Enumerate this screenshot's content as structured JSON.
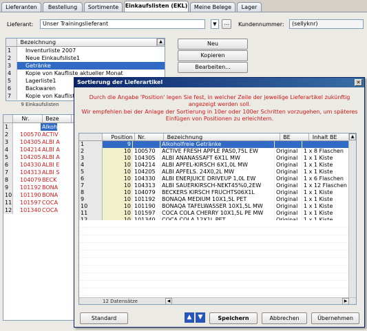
{
  "tabs": [
    "Lieferanten",
    "Bestellung",
    "Sortimente",
    "Einkaufslisten (EKL)",
    "Meine Belege",
    "Lager"
  ],
  "active_tab": 3,
  "supplier": {
    "label": "Lieferant:",
    "value": "Unser Trainingslieferant",
    "customer_label": "Kundennummer:",
    "customer_value": "(sellyknr)",
    "more_button": "..."
  },
  "purchase_lists": {
    "header": "Bezeichnung",
    "rows": [
      {
        "num": "1",
        "name": "Inventurliste 2007"
      },
      {
        "num": "2",
        "name": "Neue Einkaufsliste1"
      },
      {
        "num": "3",
        "name": "Getränke"
      },
      {
        "num": "4",
        "name": "Kopie von Kaufliste aktueller Monat"
      },
      {
        "num": "5",
        "name": "Lagerliste1"
      },
      {
        "num": "6",
        "name": "Backwaren"
      },
      {
        "num": "7",
        "name": "Kopie von Kaufliste aktueller Monat"
      }
    ],
    "selected": 2,
    "footer": "9 Einkaufslisten"
  },
  "side_buttons": {
    "new": "Neu",
    "copy": "Kopieren",
    "edit": "Bearbeiten..."
  },
  "items_list": {
    "headers": [
      "Nr.",
      "Beze"
    ],
    "rows": [
      {
        "num": "1",
        "nr": "",
        "name": "Alkoh"
      },
      {
        "num": "2",
        "nr": "100570",
        "name": "ACTIV"
      },
      {
        "num": "3",
        "nr": "104305",
        "name": "ALBI A"
      },
      {
        "num": "4",
        "nr": "104214",
        "name": "ALBI A"
      },
      {
        "num": "5",
        "nr": "104205",
        "name": "ALBI A"
      },
      {
        "num": "6",
        "nr": "104330",
        "name": "ALBI E"
      },
      {
        "num": "7",
        "nr": "104313",
        "name": "ALBI S"
      },
      {
        "num": "8",
        "nr": "104079",
        "name": "BECK"
      },
      {
        "num": "9",
        "nr": "101192",
        "name": "BONA"
      },
      {
        "num": "10",
        "nr": "101190",
        "name": "BONA"
      },
      {
        "num": "11",
        "nr": "101597",
        "name": "COCA"
      },
      {
        "num": "12",
        "nr": "101340",
        "name": "COCA"
      }
    ]
  },
  "dialog": {
    "title": "Sortierung der Lieferartikel",
    "info_line1": "Durch die Angabe 'Position' legen Sie fest, in welcher Zeile der jeweilige Lieferartikel zukünftig angezeigt werden soll.",
    "info_line2": "Wir empfehlen bei der Anlage der Sortierung in 10er oder 100er Schritten vorzugehen, um späteres Einfügen von Positionen zu erleichtern.",
    "columns": [
      "Position",
      "Nr.",
      "Bezeichnung",
      "BE",
      "Inhalt BE"
    ],
    "rows": [
      {
        "num": "1",
        "pos": "9",
        "nr": "",
        "name": "Alkoholfreie Getränke",
        "be": "",
        "inhalt": ""
      },
      {
        "num": "2",
        "pos": "10",
        "nr": "100570",
        "name": "ACTIVE FRESH APPLE PAS0,75L EW",
        "be": "Original",
        "inhalt": "1 x 8 Flaschen"
      },
      {
        "num": "3",
        "pos": "10",
        "nr": "104305",
        "name": "ALBI ANANASSAFT 6X1L MW",
        "be": "Original",
        "inhalt": "1 x 1 Kiste"
      },
      {
        "num": "4",
        "pos": "10",
        "nr": "104214",
        "name": "ALBI APFEL-KIRSCH 6X1,0L MW",
        "be": "Original",
        "inhalt": "1 x 1 Kiste"
      },
      {
        "num": "5",
        "pos": "10",
        "nr": "104205",
        "name": "ALBI APFELS. 24X0,2L MW",
        "be": "Original",
        "inhalt": "1 x 1 Kiste"
      },
      {
        "num": "6",
        "pos": "10",
        "nr": "104330",
        "name": "ALBI ENERJUICE DRIVEUP 1,0L EW",
        "be": "Original",
        "inhalt": "1 x 6 Flaschen"
      },
      {
        "num": "7",
        "pos": "10",
        "nr": "104313",
        "name": "ALBI SAUERKIRSCH-NEKT45%0,2EW",
        "be": "Original",
        "inhalt": "1 x 12 Flaschen"
      },
      {
        "num": "8",
        "pos": "10",
        "nr": "104079",
        "name": "BECKERS KIRSCH FRUCHTS06X1L",
        "be": "Original",
        "inhalt": "1 x 1 Kiste"
      },
      {
        "num": "9",
        "pos": "10",
        "nr": "101192",
        "name": "BONAQA MEDIUM 10X1,5L PET",
        "be": "Original",
        "inhalt": "1 x 1 Kiste"
      },
      {
        "num": "10",
        "pos": "10",
        "nr": "101190",
        "name": "BONAQA TAFELWASSER 10X1,5L MW",
        "be": "Original",
        "inhalt": "1 x 1 Kiste"
      },
      {
        "num": "11",
        "pos": "10",
        "nr": "101597",
        "name": "COCA COLA CHERRY 10X1,5L PE MW",
        "be": "Original",
        "inhalt": "1 x 1 Kiste"
      },
      {
        "num": "12",
        "pos": "10",
        "nr": "101340",
        "name": "COCA COLA 12X1L PET",
        "be": "Original",
        "inhalt": "1 x 1 Kiste"
      }
    ],
    "record_count": "12 Datensätze",
    "buttons": {
      "standard": "Standard",
      "save": "Speichern",
      "cancel": "Abbrechen",
      "apply": "Übernehmen"
    }
  }
}
